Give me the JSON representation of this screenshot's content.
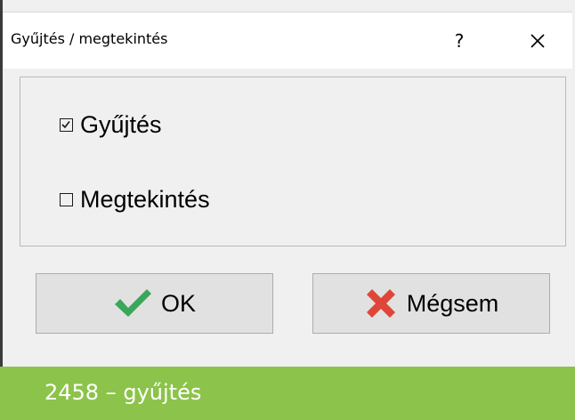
{
  "dialog": {
    "title": "Gyűjtés / megtekintés",
    "help_label": "?",
    "close_icon": "close-icon"
  },
  "options": [
    {
      "label": "Gyűjtés",
      "checked": true
    },
    {
      "label": "Megtekintés",
      "checked": false
    }
  ],
  "buttons": {
    "ok_label": "OK",
    "ok_icon": "checkmark-icon",
    "ok_icon_color": "#3aa75a",
    "cancel_label": "Mégsem",
    "cancel_icon": "cross-icon",
    "cancel_icon_color": "#e0453a"
  },
  "footer": {
    "caption": "2458 – gyűjtés",
    "background": "#8cc34a"
  }
}
